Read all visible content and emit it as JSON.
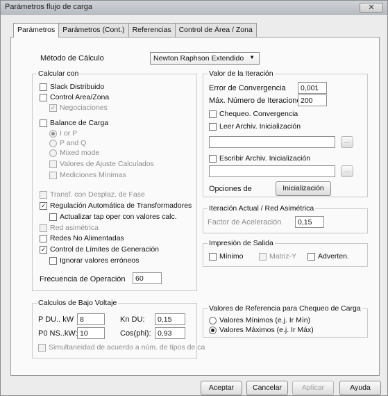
{
  "window": {
    "title": "Parámetros flujo de carga",
    "close_label": "✕"
  },
  "tabs": [
    {
      "label": "Parámetros"
    },
    {
      "label": "Parámetros (Cont.)"
    },
    {
      "label": "Referencias"
    },
    {
      "label": "Control de Área / Zona"
    }
  ],
  "metodo": {
    "label": "Método de Cálculo",
    "value": "Newton Raphson Extendido",
    "arrow": "▼"
  },
  "calcular_con": {
    "title": "Calcular con",
    "slack": "Slack Distribuido",
    "control_area": "Control Area/Zona",
    "negociaciones": "Negociaciones",
    "balance": "Balance de Carga",
    "r_iorp": "I or P",
    "r_pandq": "P and Q",
    "r_mixed": "Mixed mode",
    "valores_ajuste": "Valores de Ajuste Calculados",
    "mediciones": "Mediciones Mínimas",
    "transf": "Transf. con Desplaz. de Fase",
    "regulacion": "Regulación Automática de Transformadores",
    "actualizar_tap": "Actualizar tap oper con valores calc.",
    "red_asimetrica": "Red asimétrica",
    "redes_no_alim": "Redes No Alimentadas",
    "control_limites": "Control de Límites de Generación",
    "ignorar": "Ignorar valores erróneos",
    "frecuencia_label": "Frecuencia de Operación",
    "frecuencia_value": "60",
    "check_mark": "✓"
  },
  "iteracion": {
    "title": "Valor de la Iteración",
    "error_label": "Error de Convergencia",
    "error_value": "0,001",
    "max_label": "Máx. Número de Iteraciones",
    "max_value": "200",
    "chequeo": "Chequeo. Convergencia",
    "leer": "Leer Archiv. Inicialización",
    "leer_path": "",
    "escribir": "Escribir Archiv. Inicialización",
    "escribir_path": "",
    "browse_label": "...",
    "opciones_label": "Opciones de",
    "inicializacion_btn": "Inicialización"
  },
  "iter_actual": {
    "title": "Iteración Actual / Red Asimétrica",
    "factor_label": "Factor de Aceleración",
    "factor_value": "0,15"
  },
  "impresion": {
    "title": "Impresión de Salida",
    "minimo": "Mínimo",
    "matriz": "Matriz-Y",
    "adverten": "Adverten."
  },
  "bajo_voltaje": {
    "title": "Calculos de Bajo Voltaje",
    "pdu_label": "P DU.. kW",
    "pdu_value": "8",
    "kndu_label": "Kn DU:",
    "kndu_value": "0,15",
    "pons_label": "P0 NS..kW:",
    "pons_value": "10",
    "cosphi_label": "Cos(phi):",
    "cosphi_value": "0,93",
    "simultaneidad": "Simultaneidad de acuerdo a núm. de tipos de ca"
  },
  "referencia": {
    "title": "Valores de Referencia para Chequeo de Carga",
    "minimos": "Valores Mínimos  (e.j. Ir Mín)",
    "maximos": "Valores Máximos (e.j. Ir Máx)"
  },
  "buttons": {
    "aceptar": "Aceptar",
    "cancelar": "Cancelar",
    "aplicar": "Aplicar",
    "ayuda": "Ayuda"
  }
}
